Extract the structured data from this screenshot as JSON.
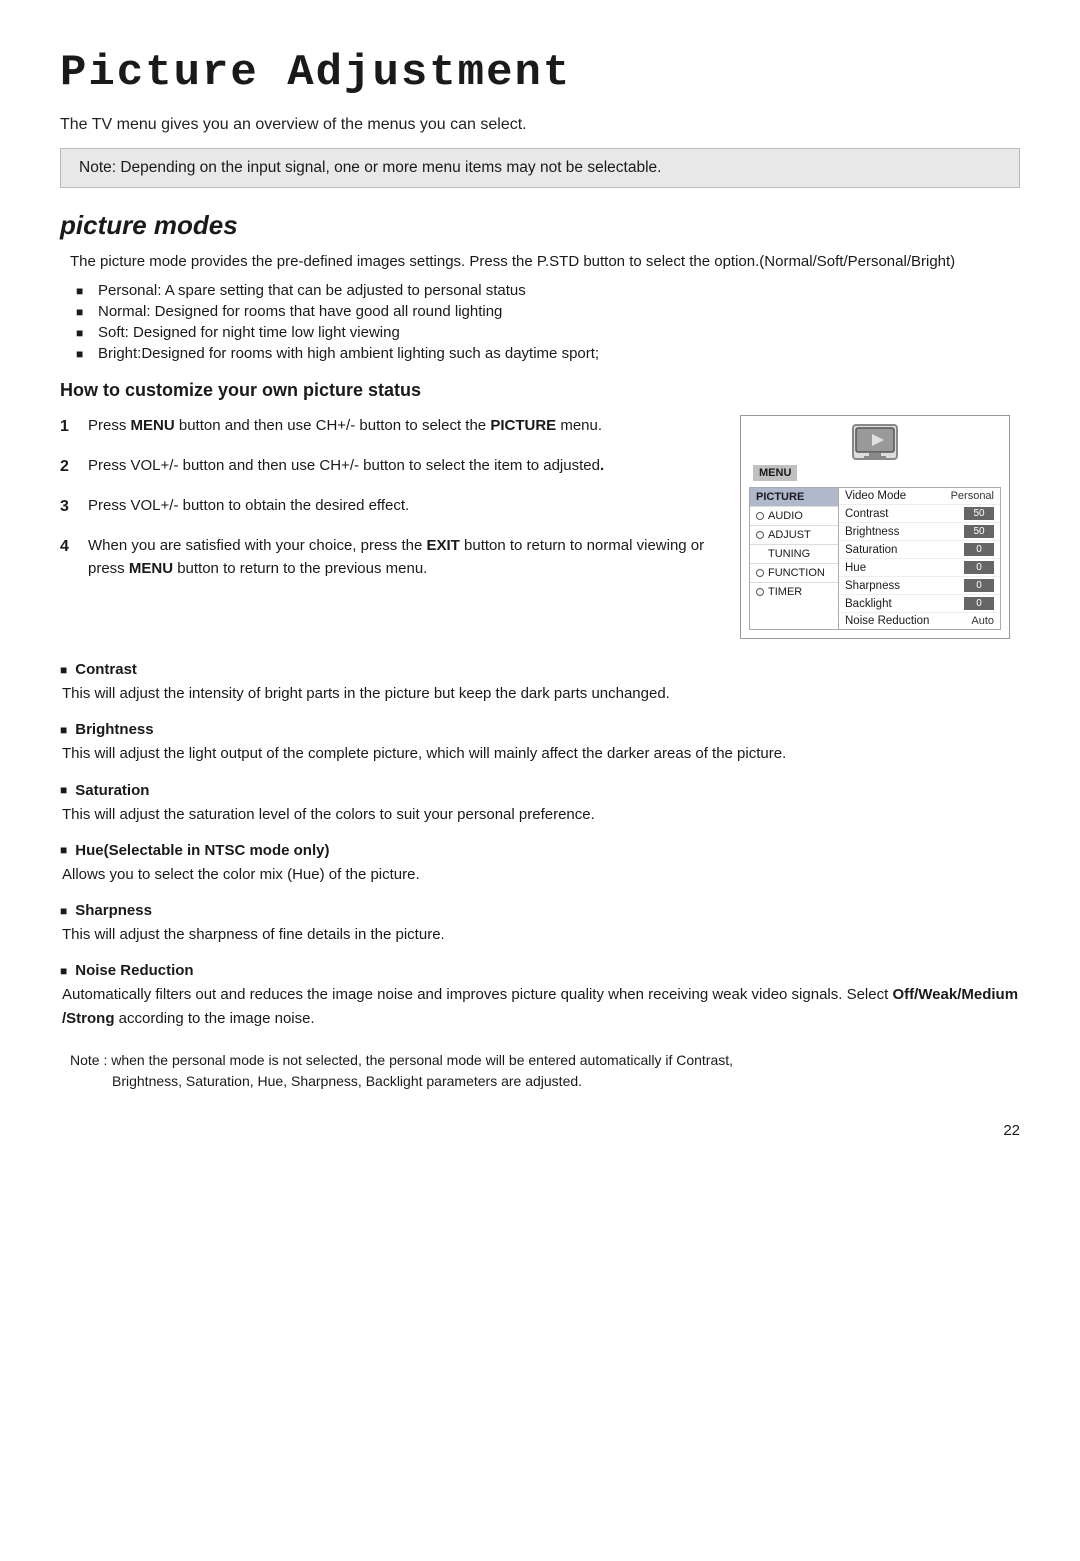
{
  "page": {
    "title": "Picture Adjustment",
    "subtitle": "The TV menu gives you an overview of the menus you can select.",
    "note_box": "Note: Depending on the input signal, one or more menu items may not be selectable.",
    "section1": {
      "heading": "picture modes",
      "intro": "The picture mode provides the pre-defined images settings. Press the P.STD button to select the option.(Normal/Soft/Personal/Bright)",
      "bullets": [
        "Personal: A spare setting that can be adjusted to personal status",
        "Normal: Designed for rooms that have good all round lighting",
        "Soft: Designed for night time low light viewing",
        "Bright:Designed for rooms with high ambient lighting such as daytime sport;"
      ]
    },
    "section2": {
      "heading": "How to customize your own picture status",
      "steps": [
        {
          "num": "1",
          "text": "Press MENU button and then use CH+/- button to select the ",
          "bold_part": "PICTURE",
          "text_after": " menu."
        },
        {
          "num": "2",
          "text": "Press VOL+/- button and then use CH+/- button to select the item to adjusted",
          "bold_part": "",
          "text_after": "."
        },
        {
          "num": "3",
          "text": "Press VOL+/- button to obtain the desired effect.",
          "bold_part": "",
          "text_after": ""
        },
        {
          "num": "4",
          "text": "When you are satisfied with your choice, press the ",
          "bold_part1": "EXIT",
          "text_mid": " button to return to normal viewing or press ",
          "bold_part2": "MENU",
          "text_after": " button to return to the previous menu."
        }
      ],
      "diagram": {
        "menu_label": "MENU",
        "left_items": [
          {
            "label": "PICTURE",
            "selected": true,
            "radio": false
          },
          {
            "label": "AUDIO",
            "selected": false,
            "radio": true
          },
          {
            "label": "ADJUST",
            "selected": false,
            "radio": true
          },
          {
            "label": "TUNING",
            "selected": false,
            "radio": false
          },
          {
            "label": "FUNCTION",
            "selected": false,
            "radio": true
          },
          {
            "label": "TIMER",
            "selected": false,
            "radio": true
          }
        ],
        "right_rows": [
          {
            "label": "Video Mode",
            "value": "Personal",
            "type": "text"
          },
          {
            "label": "Contrast",
            "value": "50",
            "type": "bar"
          },
          {
            "label": "Brightness",
            "value": "50",
            "type": "bar"
          },
          {
            "label": "Saturation",
            "value": "0",
            "type": "bar"
          },
          {
            "label": "Hue",
            "value": "0",
            "type": "bar"
          },
          {
            "label": "Sharpness",
            "value": "0",
            "type": "bar"
          },
          {
            "label": "Backlight",
            "value": "0",
            "type": "bar"
          },
          {
            "label": "Noise Reduction",
            "value": "Auto",
            "type": "text"
          }
        ]
      }
    },
    "descriptions": [
      {
        "heading": "Contrast",
        "text": "This will adjust the intensity of bright parts in the picture but keep the dark parts unchanged."
      },
      {
        "heading": "Brightness",
        "text": "This will adjust the light output of the complete picture, which will mainly affect the darker areas of the picture."
      },
      {
        "heading": "Saturation",
        "text": "This will adjust the saturation level of the colors to suit your personal preference."
      },
      {
        "heading": "Hue(Selectable in NTSC mode only)",
        "text": "Allows you to select the color mix (Hue) of the picture."
      },
      {
        "heading": "Sharpness",
        "text": "This will adjust the sharpness of fine details in the picture."
      },
      {
        "heading": "Noise Reduction",
        "text": "Automatically filters out and reduces the image noise and improves picture quality when receiving weak video signals. Select",
        "bold_select": "Off/Weak/Medium /Strong",
        "text_after": " according to the image noise."
      }
    ],
    "footer_note": "Note : when the personal mode is not selected, the personal mode will be entered automatically if Contrast,",
    "footer_note2": "Brightness, Saturation, Hue, Sharpness, Backlight parameters are adjusted.",
    "page_number": "22"
  }
}
